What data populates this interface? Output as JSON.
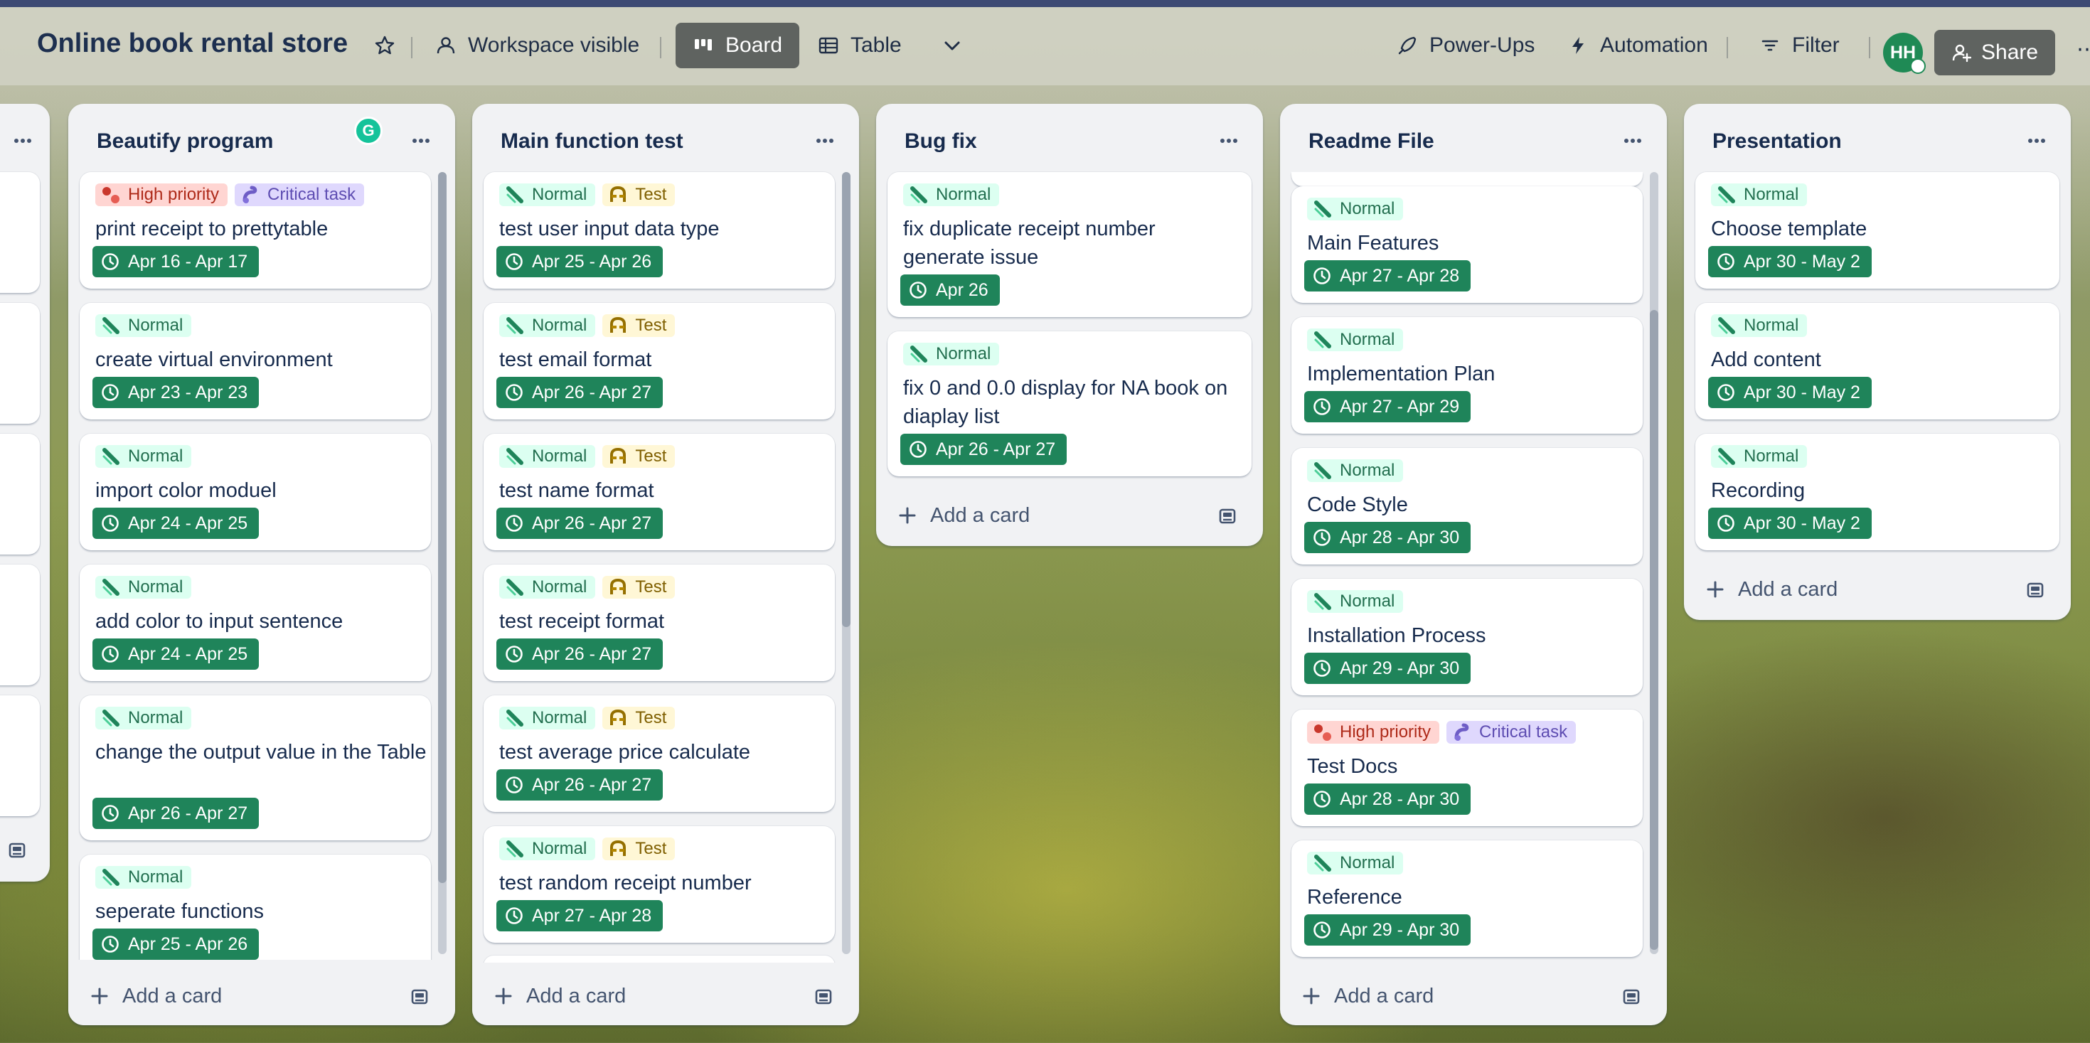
{
  "header": {
    "board_title": "Online book rental store",
    "workspace_label": "Workspace visible",
    "view_board": "Board",
    "view_table": "Table",
    "powerups": "Power-Ups",
    "automation": "Automation",
    "filter": "Filter",
    "avatar_initials": "HH",
    "share": "Share"
  },
  "colors": {
    "board_header_bg": "#d0d2c4",
    "list_bg": "#f1f2f4",
    "date_badge_bg": "#1f845a",
    "label_normal": "#dcfff1",
    "label_high": "#ffd5d2",
    "label_critical": "#dfd8fd",
    "label_test": "#fff7d6"
  },
  "lists": {
    "partial": {
      "add_card": ""
    },
    "beautify": {
      "title": "Beautify program",
      "add_card": "Add a card",
      "cards": [
        {
          "labels": [
            "High priority",
            "Critical task"
          ],
          "title": "print receipt to prettytable",
          "date": "Apr 16 - Apr 17"
        },
        {
          "labels": [
            "Normal"
          ],
          "title": "create virtual environment",
          "date": "Apr 23 - Apr 23"
        },
        {
          "labels": [
            "Normal"
          ],
          "title": "import color moduel",
          "date": "Apr 24 - Apr 25"
        },
        {
          "labels": [
            "Normal"
          ],
          "title": "add color to input sentence",
          "date": "Apr 24 - Apr 25"
        },
        {
          "labels": [
            "Normal"
          ],
          "title": "change the output value in the Table",
          "date": "Apr 26 - Apr 27"
        },
        {
          "labels": [
            "Normal"
          ],
          "title": "seperate functions",
          "date": "Apr 25 - Apr 26"
        }
      ]
    },
    "mainfn": {
      "title": "Main function test",
      "add_card": "Add a card",
      "cards": [
        {
          "labels": [
            "Normal",
            "Test"
          ],
          "title": "test user input data type",
          "date": "Apr 25 - Apr 26"
        },
        {
          "labels": [
            "Normal",
            "Test"
          ],
          "title": "test email format",
          "date": "Apr 26 - Apr 27"
        },
        {
          "labels": [
            "Normal",
            "Test"
          ],
          "title": "test name format",
          "date": "Apr 26 - Apr 27"
        },
        {
          "labels": [
            "Normal",
            "Test"
          ],
          "title": "test receipt format",
          "date": "Apr 26 - Apr 27"
        },
        {
          "labels": [
            "Normal",
            "Test"
          ],
          "title": "test average price calculate",
          "date": "Apr 26 - Apr 27"
        },
        {
          "labels": [
            "Normal",
            "Test"
          ],
          "title": "test random receipt number",
          "date": "Apr 27 - Apr 28"
        }
      ]
    },
    "bugfix": {
      "title": "Bug fix",
      "add_card": "Add a card",
      "cards": [
        {
          "labels": [
            "Normal"
          ],
          "title": "fix duplicate receipt number generate issue",
          "date": "Apr 26"
        },
        {
          "labels": [
            "Normal"
          ],
          "title": "fix 0 and 0.0 display for NA book on diaplay list",
          "date": "Apr 26 - Apr 27"
        }
      ]
    },
    "readme": {
      "title": "Readme File",
      "add_card": "Add a card",
      "cards": [
        {
          "labels": [
            "Normal"
          ],
          "title": "Main Features",
          "date": "Apr 27 - Apr 28"
        },
        {
          "labels": [
            "Normal"
          ],
          "title": "Implementation Plan",
          "date": "Apr 27 - Apr 29"
        },
        {
          "labels": [
            "Normal"
          ],
          "title": "Code Style",
          "date": "Apr 28 - Apr 30"
        },
        {
          "labels": [
            "Normal"
          ],
          "title": "Installation Process",
          "date": "Apr 29 - Apr 30"
        },
        {
          "labels": [
            "High priority",
            "Critical task"
          ],
          "title": "Test Docs",
          "date": "Apr 28 - Apr 30"
        },
        {
          "labels": [
            "Normal"
          ],
          "title": "Reference",
          "date": "Apr 29 - Apr 30"
        }
      ]
    },
    "presentation": {
      "title": "Presentation",
      "add_card": "Add a card",
      "cards": [
        {
          "labels": [
            "Normal"
          ],
          "title": "Choose template",
          "date": "Apr 30 - May 2"
        },
        {
          "labels": [
            "Normal"
          ],
          "title": "Add content",
          "date": "Apr 30 - May 2"
        },
        {
          "labels": [
            "Normal"
          ],
          "title": "Recording",
          "date": "Apr 30 - May 2"
        }
      ]
    }
  }
}
